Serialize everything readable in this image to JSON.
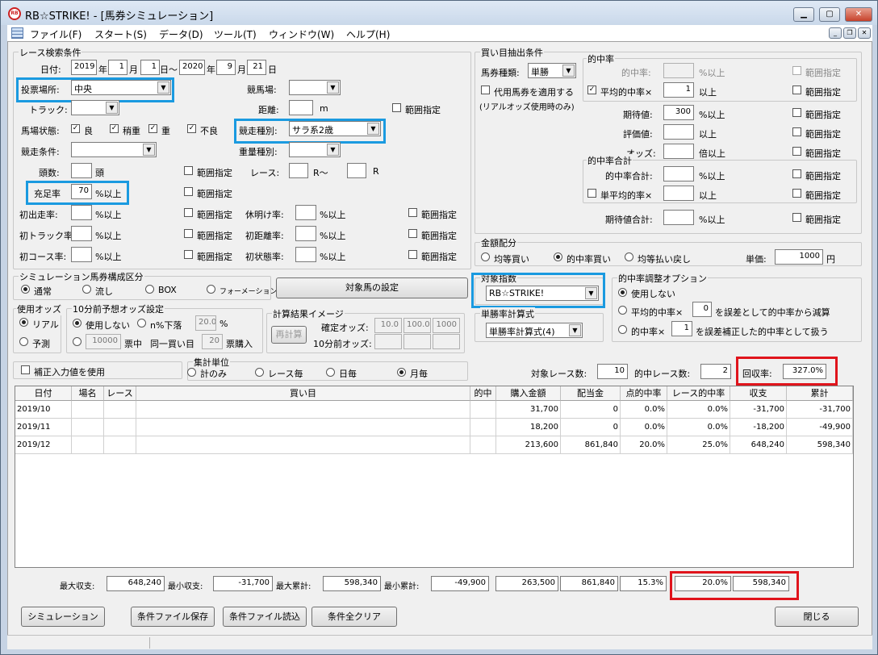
{
  "window": {
    "title": "RB☆STRIKE! - [馬券シミュレーション]",
    "icon_text": "RB"
  },
  "menu": [
    "ファイル(F)",
    "スタート(S)",
    "データ(D)",
    "ツール(T)",
    "ウィンドウ(W)",
    "ヘルプ(H)"
  ],
  "race": {
    "legend": "レース検索条件",
    "date_label": "日付:",
    "from_year": "2019",
    "year": "年",
    "from_month": "1",
    "month": "月",
    "from_day": "1",
    "day_tilde": "日～",
    "to_year": "2020",
    "to_month": "9",
    "to_day": "21",
    "day": "日",
    "venue_label": "投票場所:",
    "venue": "中央",
    "track_label": "競馬場:",
    "track_type_label": "トラック:",
    "distance_label": "距離:",
    "distance_unit": "m",
    "range": "範囲指定",
    "condition_label": "馬場状態:",
    "cond_good": "良",
    "cond_slight": "稍重",
    "cond_heavy": "重",
    "cond_bad": "不良",
    "horse_type_label": "競走種別:",
    "horse_type": "サラ系2歳",
    "race_cond_label": "競走条件:",
    "weight_label": "重量種別:",
    "heads_label": "頭数:",
    "heads_unit": "頭",
    "race_label": "レース:",
    "r_tilde": "R～",
    "r": "R",
    "fill_label": "充足率",
    "fill_value": "70",
    "pct_over": "%以上",
    "first_label": "初出走率:",
    "rest_label": "休明け率:",
    "firsttrack_label": "初トラック率:",
    "firstdist_label": "初距離率:",
    "firstcourse_label": "初コース率:",
    "firstcond_label": "初状態率:"
  },
  "buy": {
    "legend": "買い目抽出条件",
    "kind_label": "馬券種類:",
    "kind": "単勝",
    "substitute": "代用馬券を適用する",
    "substitute_note": "(リアルオッズ使用時のみ)",
    "hit_legend": "的中率",
    "hit_label": "的中率:",
    "avg_hit_label": "平均的中率×",
    "avg_hit": "1",
    "over": "以上",
    "pct_over": "%以上",
    "range": "範囲指定",
    "expect_label": "期待値:",
    "expect": "300",
    "eval_label": "評価値:",
    "odds_label": "オッズ:",
    "odds_over": "倍以上",
    "sum_legend": "的中率合計",
    "sum_label": "的中率合計:",
    "single_avg_label": "単平均的率×",
    "exp_sum_label": "期待値合計:"
  },
  "money": {
    "legend": "金額配分",
    "even_buy": "均等買い",
    "hit_buy": "的中率買い",
    "even_return": "均等払い戻し",
    "unit_label": "単価:",
    "unit": "1000",
    "yen": "円"
  },
  "sim": {
    "legend": "シミュレーション馬券構成区分",
    "normal": "通常",
    "flow": "流し",
    "box": "BOX",
    "formation": "フォーメーション",
    "target_button": "対象馬の設定"
  },
  "index": {
    "legend": "対象指数",
    "value": "RB☆STRIKE!"
  },
  "odds": {
    "legend": "使用オッズ",
    "real": "リアル",
    "forecast": "予測"
  },
  "pre10": {
    "legend": "10分前予想オッズ設定",
    "notuse": "使用しない",
    "n_drop": "n%下落",
    "n": "20.0",
    "pct": "%",
    "yen": "10000",
    "yen_label": "票中",
    "same": "同一買い目",
    "votes": "20",
    "votes_label": "票購入"
  },
  "calc": {
    "legend": "計算結果イメージ",
    "recalc": "再計算",
    "confirmed": "確定オッズ:",
    "c1": "10.0",
    "c2": "100.0",
    "c3": "1000",
    "pre10": "10分前オッズ:"
  },
  "win_calc": {
    "legend": "単勝率計算式",
    "value": "単勝率計算式(4)"
  },
  "adjust": {
    "legend": "的中率調整オプション",
    "notuse": "使用しない",
    "avg_label": "平均的中率×",
    "avg": "0",
    "avg_tail": "を誤差として的中率から減算",
    "hit_label": "的中率×",
    "hit": "1",
    "hit_tail": "を誤差補正した的中率として扱う"
  },
  "correct": "補正入力値を使用",
  "agg": {
    "legend": "集計単位",
    "total": "計のみ",
    "race": "レース毎",
    "day": "日毎",
    "month": "月毎"
  },
  "summary": {
    "target_label": "対象レース数:",
    "target": "10",
    "hit_label": "的中レース数:",
    "hit": "2",
    "recover_label": "回収率:",
    "recover": "327.0%"
  },
  "table": {
    "headers": [
      "日付",
      "場名",
      "レース",
      "買い目",
      "的中",
      "購入金額",
      "配当金",
      "点的中率",
      "レース的中率",
      "収支",
      "累計"
    ],
    "rows": [
      [
        "2019/10",
        "",
        "",
        "",
        "",
        "31,700",
        "0",
        "0.0%",
        "0.0%",
        "-31,700",
        "-31,700"
      ],
      [
        "2019/11",
        "",
        "",
        "",
        "",
        "18,200",
        "0",
        "0.0%",
        "0.0%",
        "-18,200",
        "-49,900"
      ],
      [
        "2019/12",
        "",
        "",
        "",
        "",
        "213,600",
        "861,840",
        "20.0%",
        "25.0%",
        "648,240",
        "598,340"
      ]
    ]
  },
  "totals": {
    "max_label": "最大収支:",
    "max": "648,240",
    "min_label": "最小収支:",
    "min": "-31,700",
    "maxcum_label": "最大累計:",
    "maxcum": "598,340",
    "mincum_label": "最小累計:",
    "mincum": "-49,900",
    "buy": "263,500",
    "pay": "861,840",
    "pt": "15.3%",
    "race": "20.0%",
    "cum": "598,340"
  },
  "buttons": {
    "simulate": "シミュレーション",
    "save": "条件ファイル保存",
    "load": "条件ファイル読込",
    "clear": "条件全クリア",
    "close": "閉じる"
  }
}
